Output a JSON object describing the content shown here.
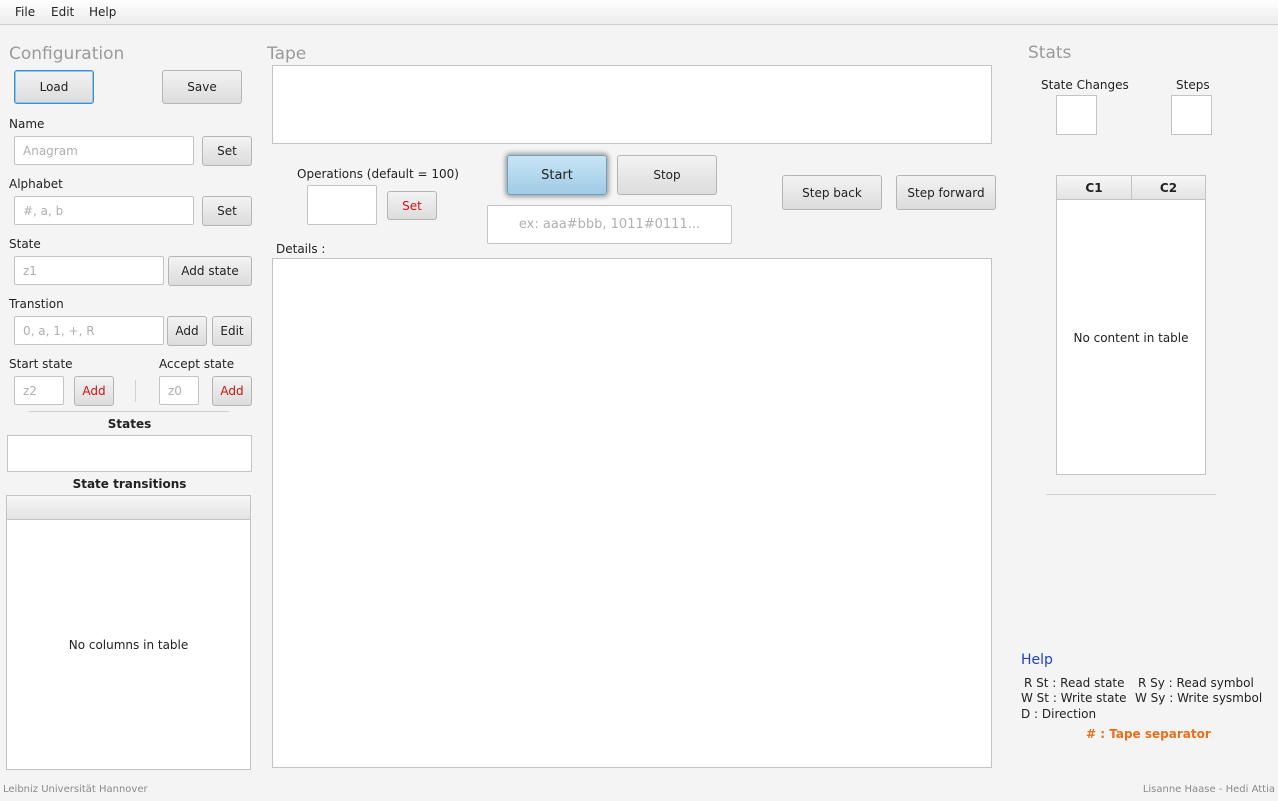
{
  "menu": {
    "file": "File",
    "edit": "Edit",
    "help": "Help"
  },
  "config": {
    "title": "Configuration",
    "load": "Load",
    "save": "Save",
    "name_label": "Name",
    "name_placeholder": "Anagram",
    "name_set": "Set",
    "alphabet_label": "Alphabet",
    "alphabet_placeholder": "#, a, b",
    "alphabet_set": "Set",
    "state_label": "State",
    "state_placeholder": "z1",
    "add_state": "Add state",
    "transition_label": "Transtion",
    "transition_placeholder": "0, a, 1, +, R",
    "transition_add": "Add",
    "transition_edit": "Edit",
    "start_state_label": "Start state",
    "start_state_placeholder": "z2",
    "start_state_add": "Add",
    "accept_state_label": "Accept state",
    "accept_state_placeholder": "z0",
    "accept_state_add": "Add",
    "states_header": "States",
    "transitions_header": "State transitions",
    "transitions_empty": "No columns in table"
  },
  "tape": {
    "title": "Tape",
    "operations_label": "Operations (default = 100)",
    "operations_set": "Set",
    "start": "Start",
    "stop": "Stop",
    "input_placeholder": "ex: aaa#bbb, 1011#0111...",
    "step_back": "Step back",
    "step_forward": "Step forward",
    "details_label": "Details :"
  },
  "stats": {
    "title": "Stats",
    "state_changes_label": "State Changes",
    "steps_label": "Steps",
    "table_columns": [
      "C1",
      "C2"
    ],
    "table_empty": "No content in table"
  },
  "help": {
    "title": "Help",
    "line1_left": "R St : Read state",
    "line1_right": "R Sy : Read symbol",
    "line2_left": "W St : Write state",
    "line2_right": "W Sy : Write sysmbol",
    "line3": "D : Direction",
    "separator": "# : Tape separator"
  },
  "footer": {
    "left": "Leibniz Universität Hannover",
    "right": "Lisanne Haase - Hedi Attia"
  },
  "colors": {
    "accent_red": "#d01212",
    "help_blue": "#1c3fd8",
    "separator_orange": "#e8701a",
    "start_button": "#a9d3ec"
  }
}
